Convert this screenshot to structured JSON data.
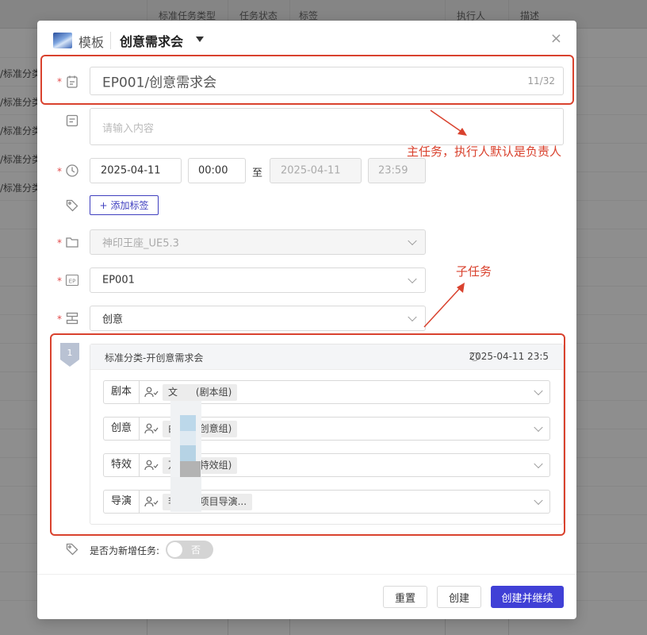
{
  "background": {
    "headers": [
      "标准任务类型",
      "任务状态",
      "标签",
      "执行人",
      "描述"
    ],
    "rows": [
      "/标准分类",
      "/标准分类",
      "/标准分类",
      "/标准分类",
      "/标准分类"
    ]
  },
  "modal": {
    "template_label": "模板",
    "title": "创意需求会",
    "close": "×"
  },
  "form": {
    "name_value": "EP001/创意需求会",
    "name_counter": "11/32",
    "desc_placeholder": "请输入内容",
    "start_date": "2025-04-11",
    "start_time": "00:00",
    "to": "至",
    "end_date": "2025-04-11",
    "end_time": "23:59",
    "add_tag": "添加标签",
    "project": "神印王座_UE5.3",
    "episode": "EP001",
    "stage": "创意",
    "required_mark": "*"
  },
  "subtask": {
    "index": "1",
    "title": "标准分类-开创意需求会",
    "datetime": "2025-04-11 23:5",
    "rows": [
      {
        "label": "剧本",
        "assignee": "文",
        "group": "(剧本组)"
      },
      {
        "label": "创意",
        "assignee": "由",
        "group": "(创意组)"
      },
      {
        "label": "特效",
        "assignee": "万",
        "group": "(特效组)"
      },
      {
        "label": "导演",
        "assignee": "李",
        "group": "(项目导演..."
      }
    ]
  },
  "new_task": {
    "label": "是否为新增任务:",
    "toggle": "否"
  },
  "footer": {
    "reset": "重置",
    "create": "创建",
    "create_continue": "创建并继续"
  },
  "annotations": {
    "main_task_note": "主任务，执行人默认是负责人",
    "subtask_note": "子任务",
    "color": "#d9422e"
  },
  "colors": {
    "primary": "#4040d6",
    "required": "#e24b4b"
  }
}
